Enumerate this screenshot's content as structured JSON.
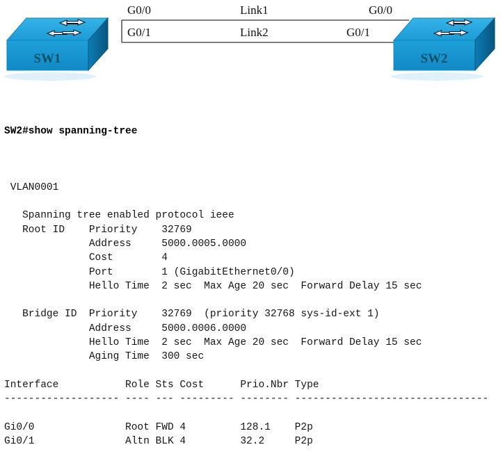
{
  "diagram": {
    "left_switch": {
      "name": "SW1",
      "icon": "switch-icon"
    },
    "right_switch": {
      "name": "SW2",
      "icon": "switch-icon"
    },
    "links": [
      {
        "name": "Link1",
        "left_interface": "G0/0",
        "right_interface": "G0/0"
      },
      {
        "name": "Link2",
        "left_interface": "G0/1",
        "right_interface": "G0/1"
      }
    ],
    "colors": {
      "switch_top": "#29a8e0",
      "switch_front": "#1896d3",
      "switch_side": "#0a6fa8",
      "switch_label": "#0d4f63",
      "link_line": "#555555"
    }
  },
  "terminal": {
    "prompt_line": "SW2#show spanning-tree",
    "lines": [
      "",
      " VLAN0001",
      "",
      "   Spanning tree enabled protocol ieee",
      "   Root ID    Priority    32769",
      "              Address     5000.0005.0000",
      "              Cost        4",
      "              Port        1 (GigabitEthernet0/0)",
      "              Hello Time  2 sec  Max Age 20 sec  Forward Delay 15 sec",
      "",
      "   Bridge ID  Priority    32769  (priority 32768 sys-id-ext 1)",
      "              Address     5000.0006.0000",
      "              Hello Time  2 sec  Max Age 20 sec  Forward Delay 15 sec",
      "              Aging Time  300 sec",
      "",
      "Interface           Role Sts Cost      Prio.Nbr Type",
      "------------------- ---- --- --------- -------- --------------------------------",
      "",
      "Gi0/0               Root FWD 4         128.1    P2p",
      "Gi0/1               Altn BLK 4         32.2     P2p"
    ],
    "vlan": "VLAN0001",
    "protocol_line": "Spanning tree enabled protocol ieee",
    "root_id": {
      "label": "Root ID",
      "priority": "32769",
      "address": "5000.0005.0000",
      "cost": "4",
      "port": "1 (GigabitEthernet0/0)",
      "hello_time": "2 sec",
      "max_age": "20 sec",
      "forward_delay": "15 sec"
    },
    "bridge_id": {
      "label": "Bridge ID",
      "priority": "32769 (priority 32768 sys-id-ext 1)",
      "address": "5000.0006.0000",
      "hello_time": "2 sec",
      "max_age": "20 sec",
      "forward_delay": "15 sec",
      "aging_time": "300 sec"
    },
    "table": {
      "headers": [
        "Interface",
        "Role",
        "Sts",
        "Cost",
        "Prio.Nbr",
        "Type"
      ],
      "rows": [
        [
          "Gi0/0",
          "Root",
          "FWD",
          "4",
          "128.1",
          "P2p"
        ],
        [
          "Gi0/1",
          "Altn",
          "BLK",
          "4",
          "32.2",
          "P2p"
        ]
      ]
    }
  }
}
